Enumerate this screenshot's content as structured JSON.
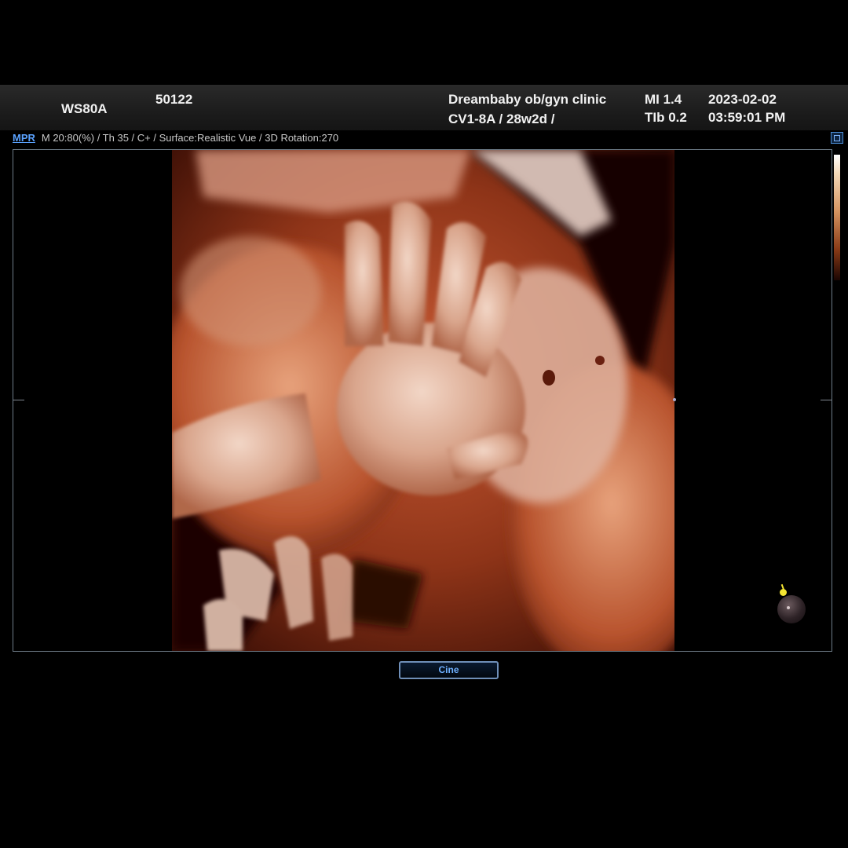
{
  "header": {
    "system": "WS80A",
    "patient_id": "50122",
    "clinic": "Dreambaby ob/gyn clinic",
    "probe_ga": "CV1-8A / 28w2d /",
    "mi": "MI  1.4",
    "tib": "TIb 0.2",
    "date": "2023-02-02",
    "time": "03:59:01 PM"
  },
  "subbar": {
    "mode_link": "MPR",
    "params": "M 20:80(%) / Th 35 / C+ / Surface:Realistic Vue / 3D Rotation:270"
  },
  "viewport": {
    "render_content": "3D fetal ultrasound surface render",
    "colorbar_colors": [
      "#ffffff",
      "#f3d9b8",
      "#d49461",
      "#8a3b17",
      "#1a0502"
    ]
  },
  "icons": {
    "view_layout": "layout-icon",
    "trackball": "trackball-icon",
    "pin": "pin-icon"
  },
  "buttons": {
    "cine": "Cine"
  }
}
